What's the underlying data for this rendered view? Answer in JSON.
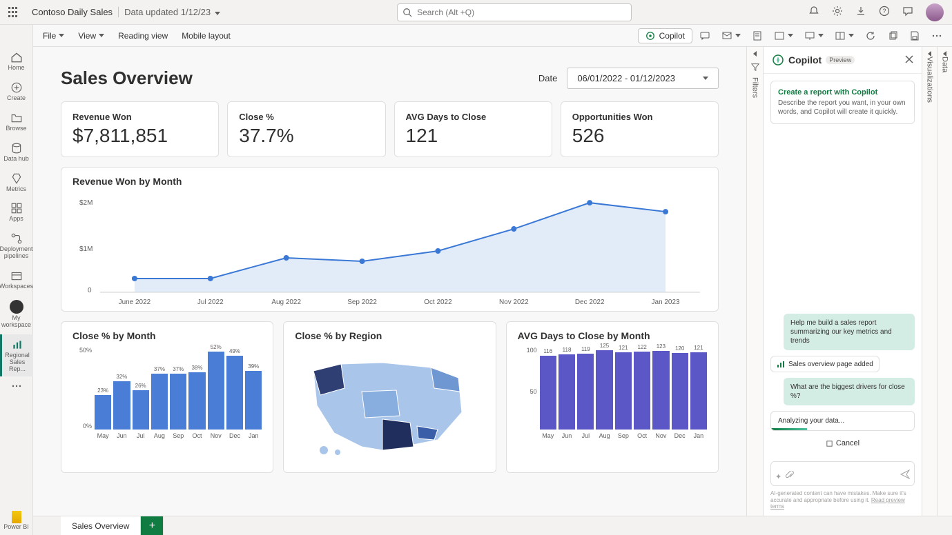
{
  "topbar": {
    "title": "Contoso Daily Sales",
    "subtitle": "Data updated 1/12/23",
    "search_placeholder": "Search (Alt +Q)"
  },
  "ribbon": {
    "file": "File",
    "view": "View",
    "reading": "Reading view",
    "mobile": "Mobile layout",
    "copilot": "Copilot"
  },
  "leftrail": {
    "home": "Home",
    "create": "Create",
    "browse": "Browse",
    "datahub": "Data hub",
    "metrics": "Metrics",
    "apps": "Apps",
    "pipelines": "Deployment pipelines",
    "workspaces": "Workspaces",
    "my": "My workspace",
    "regional": "Regional Sales Rep...",
    "powerbi": "Power BI"
  },
  "report": {
    "title": "Sales Overview",
    "date_label": "Date",
    "date_range": "06/01/2022 - 01/12/2023"
  },
  "kpis": [
    {
      "label": "Revenue Won",
      "value": "$7,811,851"
    },
    {
      "label": "Close %",
      "value": "37.7%"
    },
    {
      "label": "AVG Days to Close",
      "value": "121"
    },
    {
      "label": "Opportunities Won",
      "value": "526"
    }
  ],
  "charts": {
    "revenue": {
      "title": "Revenue Won by Month"
    },
    "closepct": {
      "title": "Close % by Month"
    },
    "region": {
      "title": "Close % by Region"
    },
    "avgdays": {
      "title": "AVG Days to Close by Month"
    }
  },
  "filters": {
    "label": "Filters"
  },
  "viz": {
    "label": "Visualizations"
  },
  "dataTab": {
    "label": "Data"
  },
  "copilot": {
    "title": "Copilot",
    "badge": "Preview",
    "suggest_title": "Create a report with Copilot",
    "suggest_desc": "Describe the report you want, in your own words, and Copilot will create it quickly.",
    "user1": "Help me build a sales report summarizing our key metrics and trends",
    "assistant1": "Sales overview page added",
    "user2": "What are the biggest drivers for close %?",
    "status": "Analyzing your data...",
    "cancel": "Cancel",
    "footer": "AI-generated content can have mistakes. Make sure it's accurate and appropriate before using it.",
    "footer_link": "Read preview terms"
  },
  "tabs": {
    "t1": "Sales Overview"
  },
  "chart_data": [
    {
      "type": "line",
      "title": "Revenue Won by Month",
      "categories": [
        "June 2022",
        "Jul 2022",
        "Aug 2022",
        "Sep 2022",
        "Oct 2022",
        "Nov 2022",
        "Dec 2022",
        "Jan 2023"
      ],
      "values": [
        500000,
        500000,
        900000,
        800000,
        1000000,
        1450000,
        2000000,
        1850000
      ],
      "ylabel": "",
      "xlabel": "",
      "yticks": [
        "0",
        "$1M",
        "$2M"
      ],
      "ylim": [
        0,
        2000000
      ]
    },
    {
      "type": "bar",
      "title": "Close % by Month",
      "categories": [
        "May",
        "Jun",
        "Jul",
        "Aug",
        "Sep",
        "Oct",
        "Nov",
        "Dec",
        "Jan"
      ],
      "values": [
        23,
        32,
        26,
        37,
        37,
        38,
        52,
        49,
        39
      ],
      "value_labels": [
        "23%",
        "32%",
        "26%",
        "37%",
        "37%",
        "38%",
        "52%",
        "49%",
        "39%"
      ],
      "yticks": [
        "0%",
        "50%"
      ],
      "ylim": [
        0,
        55
      ]
    },
    {
      "type": "map",
      "title": "Close % by Region",
      "region": "US states choropleth",
      "scale": "lighter to darker blue = higher close %"
    },
    {
      "type": "bar",
      "title": "AVG Days to Close by Month",
      "categories": [
        "May",
        "Jun",
        "Jul",
        "Aug",
        "Sep",
        "Oct",
        "Nov",
        "Dec",
        "Jan"
      ],
      "values": [
        116,
        118,
        119,
        125,
        121,
        122,
        123,
        120,
        121
      ],
      "value_labels": [
        "116",
        "118",
        "119",
        "125",
        "121",
        "122",
        "123",
        "120",
        "121"
      ],
      "yticks": [
        "50",
        "100"
      ],
      "ylim": [
        0,
        130
      ]
    }
  ]
}
